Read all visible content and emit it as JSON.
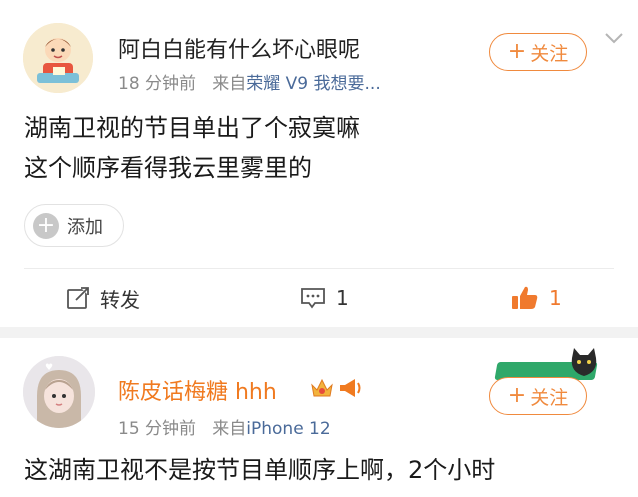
{
  "posts": [
    {
      "username": "阿白白能有什么坏心眼呢",
      "time": "18 分钟前",
      "source_prefix": "来自",
      "source": "荣耀 V9 我想要...",
      "follow_label": "关注",
      "content_lines": [
        "湖南卫视的节目单出了个寂寞嘛",
        "这个顺序看得我云里雾里的"
      ],
      "add_label": "添加",
      "repost_label": "转发",
      "comment_count": "1",
      "like_count": "1"
    },
    {
      "username": "陈皮话梅糖 hhh",
      "time": "15 分钟前",
      "source_prefix": "来自",
      "source": "iPhone 12",
      "follow_label": "关注",
      "content_lines": [
        "这湖南卫视不是按节目单顺序上啊，2个小时"
      ]
    }
  ],
  "colors": {
    "accent": "#f08a3e",
    "like": "#f07a2e",
    "source_link": "#4a6a99",
    "username_vip": "#f07a20"
  },
  "icons": [
    "plus-icon",
    "chevron-down-icon",
    "repost-icon",
    "comment-icon",
    "like-icon",
    "crown-badge-icon",
    "megaphone-badge-icon"
  ]
}
